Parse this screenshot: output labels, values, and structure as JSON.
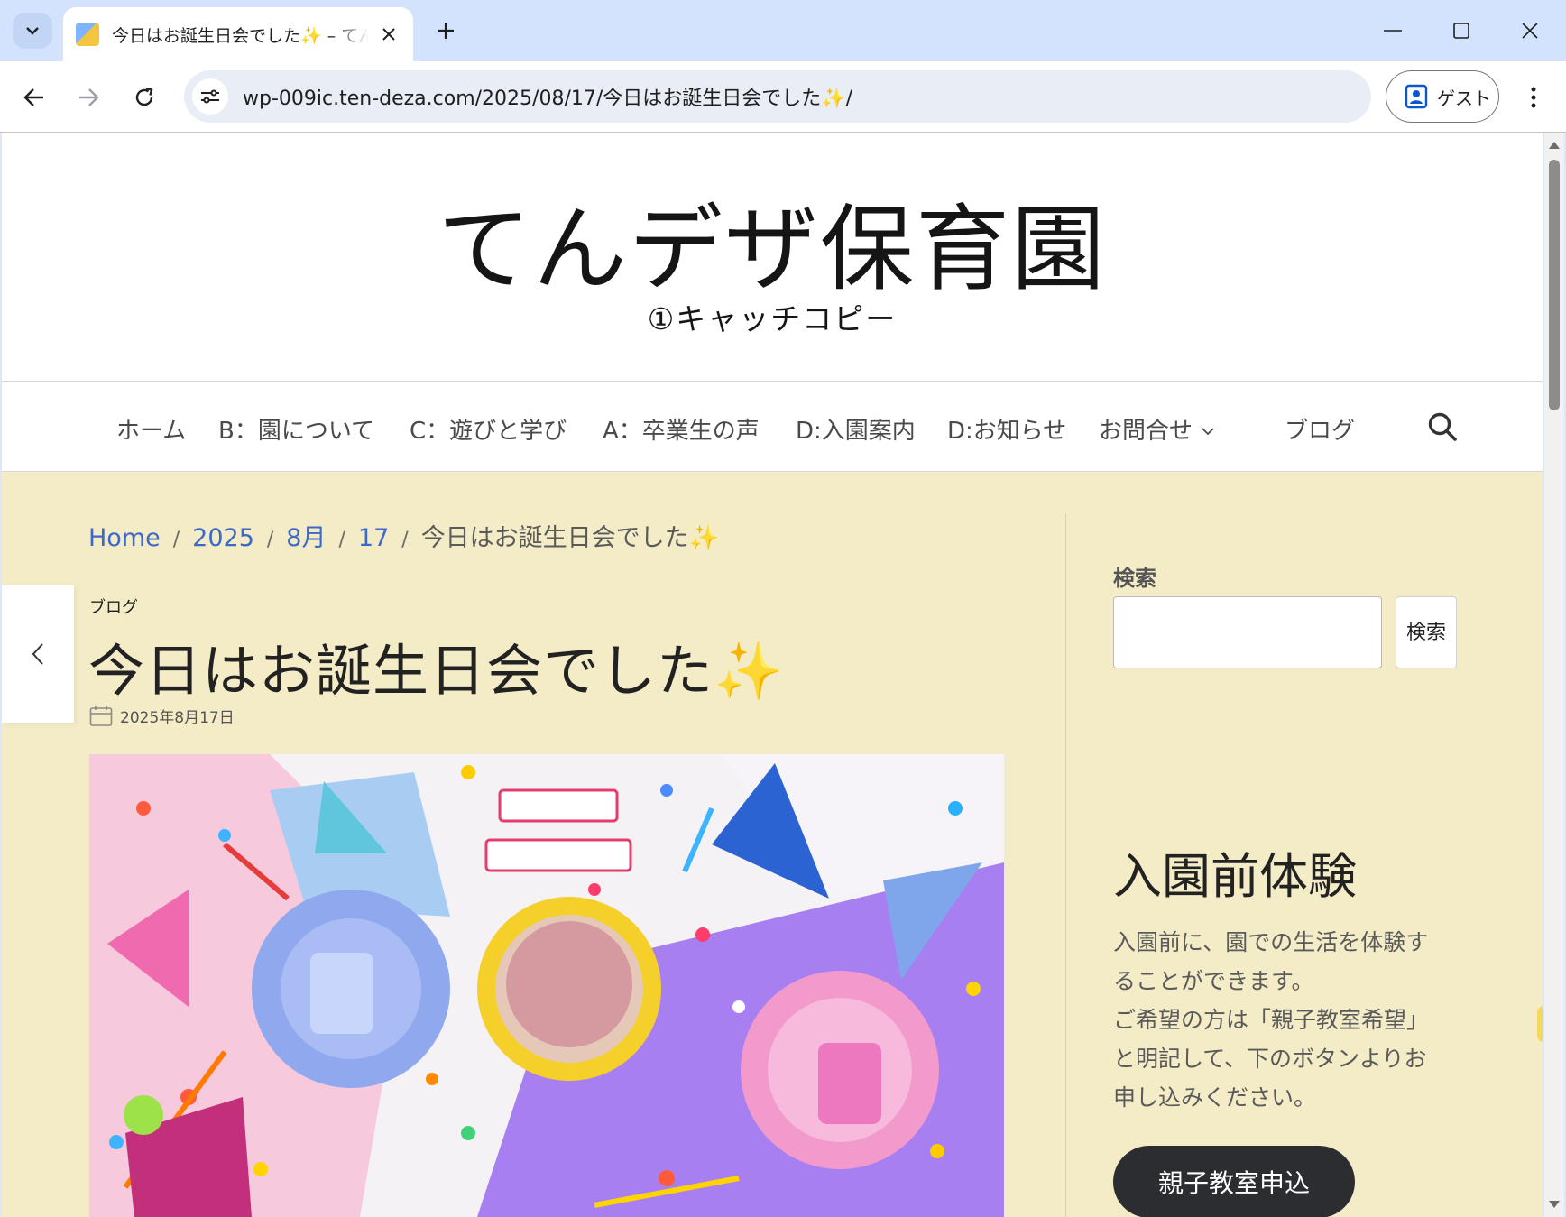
{
  "browser": {
    "tab_title": "今日はお誕生日会でした✨ – てん",
    "url": "wp-009ic.ten-deza.com/2025/08/17/今日はお誕生日会でした✨/",
    "profile_label": "ゲスト"
  },
  "site": {
    "title": "てんデザ保育園",
    "tagline": "①キャッチコピー"
  },
  "nav": {
    "items": [
      "ホーム",
      "B：園について",
      "C：遊びと学び",
      "A：卒業生の声",
      "D:入園案内",
      "D:お知らせ",
      "お問合せ",
      "ブログ"
    ]
  },
  "breadcrumb": {
    "home": "Home",
    "year": "2025",
    "month": "8月",
    "day": "17",
    "current": "今日はお誕生日会でした✨"
  },
  "post": {
    "category": "ブログ",
    "title": "今日はお誕生日会でした✨",
    "date": "2025年8月17日"
  },
  "sidebar": {
    "search_label": "検索",
    "search_button": "検索",
    "widget_heading": "入園前体験",
    "widget_lines": [
      "入園前に、園での生活を体験す",
      "ることができます。",
      "ご希望の方は「親子教室希望」",
      "と明記して、下のボタンよりお",
      "申し込みください。"
    ],
    "cta_label": "親子教室申込"
  },
  "colors": {
    "content_background": "#f3ecc7",
    "link": "#3d68c9",
    "cta_background": "#2b2d31",
    "tabbar": "#d3e3fd"
  }
}
